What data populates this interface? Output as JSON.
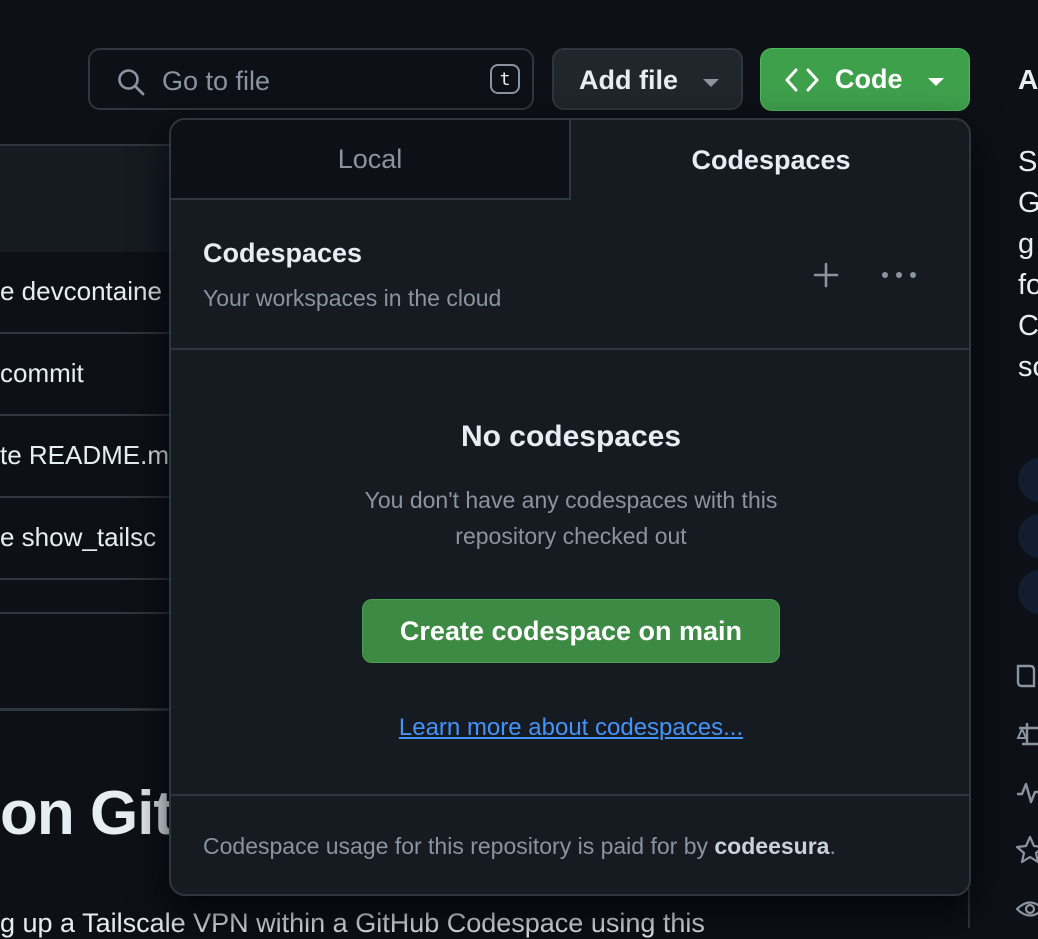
{
  "toolbar": {
    "search_placeholder": "Go to file",
    "search_shortcut": "t",
    "add_file_label": "Add file",
    "code_label": "Code"
  },
  "background": {
    "file_rows": [
      "e devcontaine",
      " commit",
      "te README.m",
      "e show_tailsc"
    ],
    "heading": "on GitH",
    "paragraph": "g up a Tailscale VPN within a GitHub Codespace using this"
  },
  "sidebar": {
    "title": "A",
    "text_lines": [
      "S",
      "G",
      "g",
      "fo",
      "C",
      "so"
    ]
  },
  "popover": {
    "tabs": [
      {
        "label": "Local",
        "active": false
      },
      {
        "label": "Codespaces",
        "active": true
      }
    ],
    "section_title": "Codespaces",
    "section_subtitle": "Your workspaces in the cloud",
    "empty_title": "No codespaces",
    "empty_description": "You don't have any codespaces with this repository checked out",
    "create_button": "Create codespace on main",
    "learn_more_link": "Learn more about codespaces...",
    "footer_prefix": "Codespace usage for this repository is paid for by ",
    "footer_owner": "codeesura",
    "footer_suffix": "."
  },
  "colors": {
    "page_bg": "#0d1117",
    "panel_bg": "#161b22",
    "border": "#30363d",
    "primary_green": "#3fa04c",
    "link_blue": "#4493f8",
    "muted_text": "#8b949e"
  },
  "icons": [
    "search-icon",
    "chevron-down-icon",
    "code-icon",
    "plus-icon",
    "kebab-horizontal-icon",
    "book-icon",
    "law-icon",
    "pulse-icon",
    "star-icon",
    "eye-icon"
  ]
}
